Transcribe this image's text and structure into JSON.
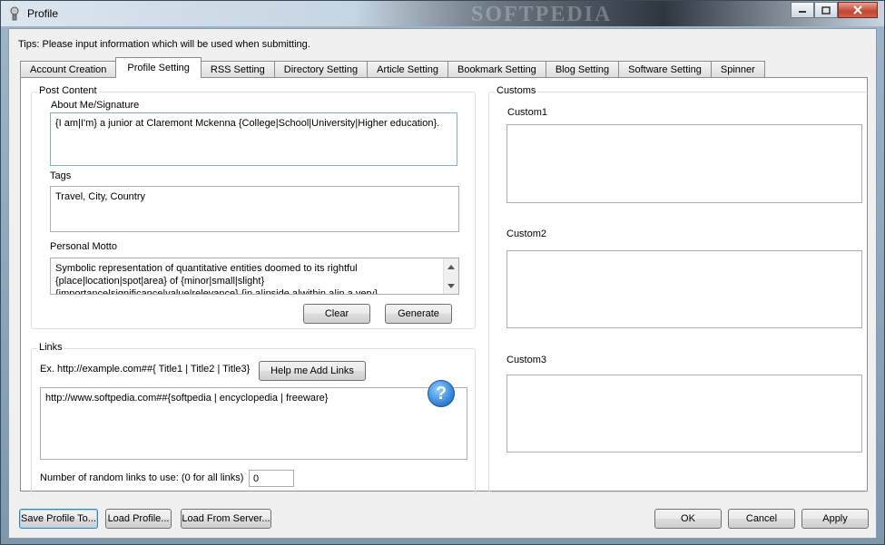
{
  "window": {
    "title": "Profile",
    "watermark": "SOFTPEDIA"
  },
  "tips": "Tips: Please input information which will be used when submitting.",
  "tabs": [
    {
      "label": "Account Creation"
    },
    {
      "label": "Profile Setting"
    },
    {
      "label": "RSS Setting"
    },
    {
      "label": "Directory Setting"
    },
    {
      "label": "Article Setting"
    },
    {
      "label": "Bookmark Setting"
    },
    {
      "label": "Blog Setting"
    },
    {
      "label": "Software Setting"
    },
    {
      "label": "Spinner"
    }
  ],
  "active_tab": "Profile Setting",
  "post_content": {
    "group_label": "Post Content",
    "about_label": "About Me/Signature",
    "about_value": "{I am|I'm} a junior at Claremont Mckenna {College|School|University|Higher education}.",
    "tags_label": "Tags",
    "tags_value": "Travel, City, Country",
    "motto_label": "Personal Motto",
    "motto_value": "Symbolic representation of quantitative entities doomed to its rightful {place|location|spot|area} of {minor|small|slight} {importance|significance|value|relevance} {in a|inside a|within a|in a very} {world|global|planet|entire world} {where|exactly where|in which|",
    "clear_label": "Clear",
    "generate_label": "Generate"
  },
  "links": {
    "group_label": "Links",
    "example_label": "Ex. http://example.com##{ Title1 | Title2 | Title3}",
    "help_button_label": "Help me Add Links",
    "help_icon_glyph": "?",
    "links_value": "http://www.softpedia.com##{softpedia | encyclopedia | freeware}",
    "random_label": "Number of random links to use: (0 for all links)",
    "random_value": "0"
  },
  "customs": {
    "group_label": "Customs",
    "custom1_label": "Custom1",
    "custom2_label": "Custom2",
    "custom3_label": "Custom3"
  },
  "buttons": {
    "save_profile": "Save Profile To...",
    "load_profile": "Load Profile...",
    "load_server": "Load From Server...",
    "ok": "OK",
    "cancel": "Cancel",
    "apply": "Apply"
  }
}
